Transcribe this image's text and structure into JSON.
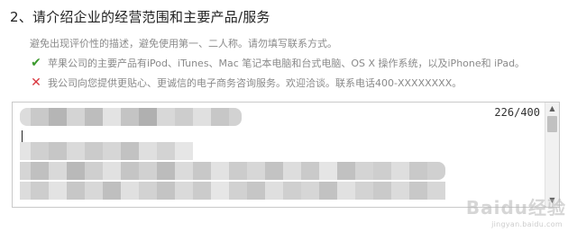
{
  "question": {
    "title": "2、请介绍企业的经营范围和主要产品/服务"
  },
  "hint": {
    "text": "避免出现评价性的描述，避免使用第一、二人称。请勿填写联系方式。"
  },
  "examples": {
    "good_icon": "check-icon",
    "good_color": "#3c9a2e",
    "good_text": "苹果公司的主要产品有iPod、iTunes、Mac 笔记本电脑和台式电脑、OS X 操作系统，以及iPhone和 iPad。",
    "bad_icon": "cross-icon",
    "bad_color": "#d9363e",
    "bad_text": "我公司向您提供更贴心、更诚信的电子商务咨询服务。欢迎洽谈。联系电话400-XXXXXXXX。"
  },
  "textarea": {
    "char_count": "226/400"
  },
  "watermark": {
    "brand": "Baidu经验",
    "url": "jingyan.baidu.com"
  }
}
